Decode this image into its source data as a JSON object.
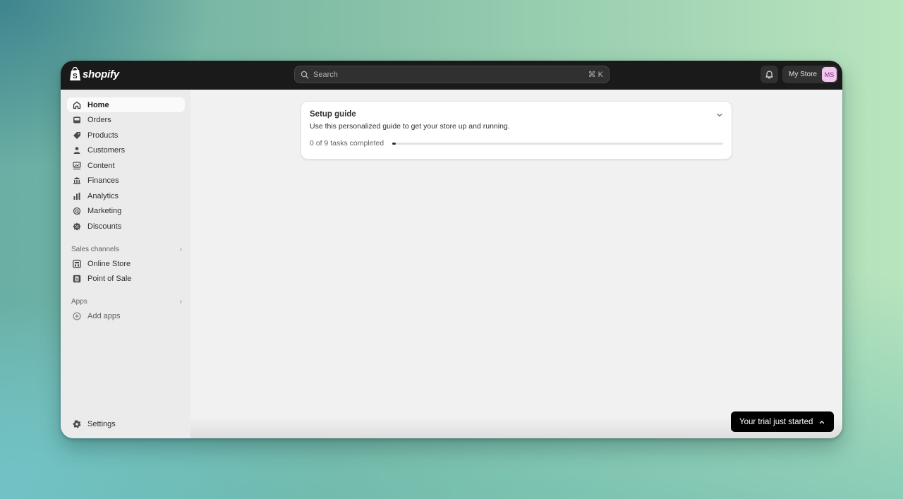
{
  "app": {
    "brand": "shopify"
  },
  "topbar": {
    "search_placeholder": "Search",
    "search_shortcut": "⌘ K",
    "store_name": "My Store",
    "avatar_initials": "MS",
    "avatar_color": "#f2c4f0"
  },
  "sidebar": {
    "items": [
      {
        "label": "Home",
        "icon": "home-icon",
        "active": true
      },
      {
        "label": "Orders",
        "icon": "inbox-icon"
      },
      {
        "label": "Products",
        "icon": "tag-icon"
      },
      {
        "label": "Customers",
        "icon": "person-icon"
      },
      {
        "label": "Content",
        "icon": "content-icon"
      },
      {
        "label": "Finances",
        "icon": "bank-icon"
      },
      {
        "label": "Analytics",
        "icon": "bar-chart-icon"
      },
      {
        "label": "Marketing",
        "icon": "target-icon"
      },
      {
        "label": "Discounts",
        "icon": "discount-icon"
      }
    ],
    "sales_channels": {
      "label": "Sales channels",
      "items": [
        {
          "label": "Online Store",
          "icon": "store-icon"
        },
        {
          "label": "Point of Sale",
          "icon": "pos-icon"
        }
      ]
    },
    "apps": {
      "label": "Apps",
      "items": [
        {
          "label": "Add apps",
          "icon": "plus-circle-icon"
        }
      ]
    },
    "settings_label": "Settings"
  },
  "setup_guide": {
    "title": "Setup guide",
    "description": "Use this personalized guide to get your store up and running.",
    "progress_text": "0 of 9 tasks completed",
    "tasks_completed": 0,
    "tasks_total": 9
  },
  "trial_banner": {
    "label": "Your trial just started"
  }
}
